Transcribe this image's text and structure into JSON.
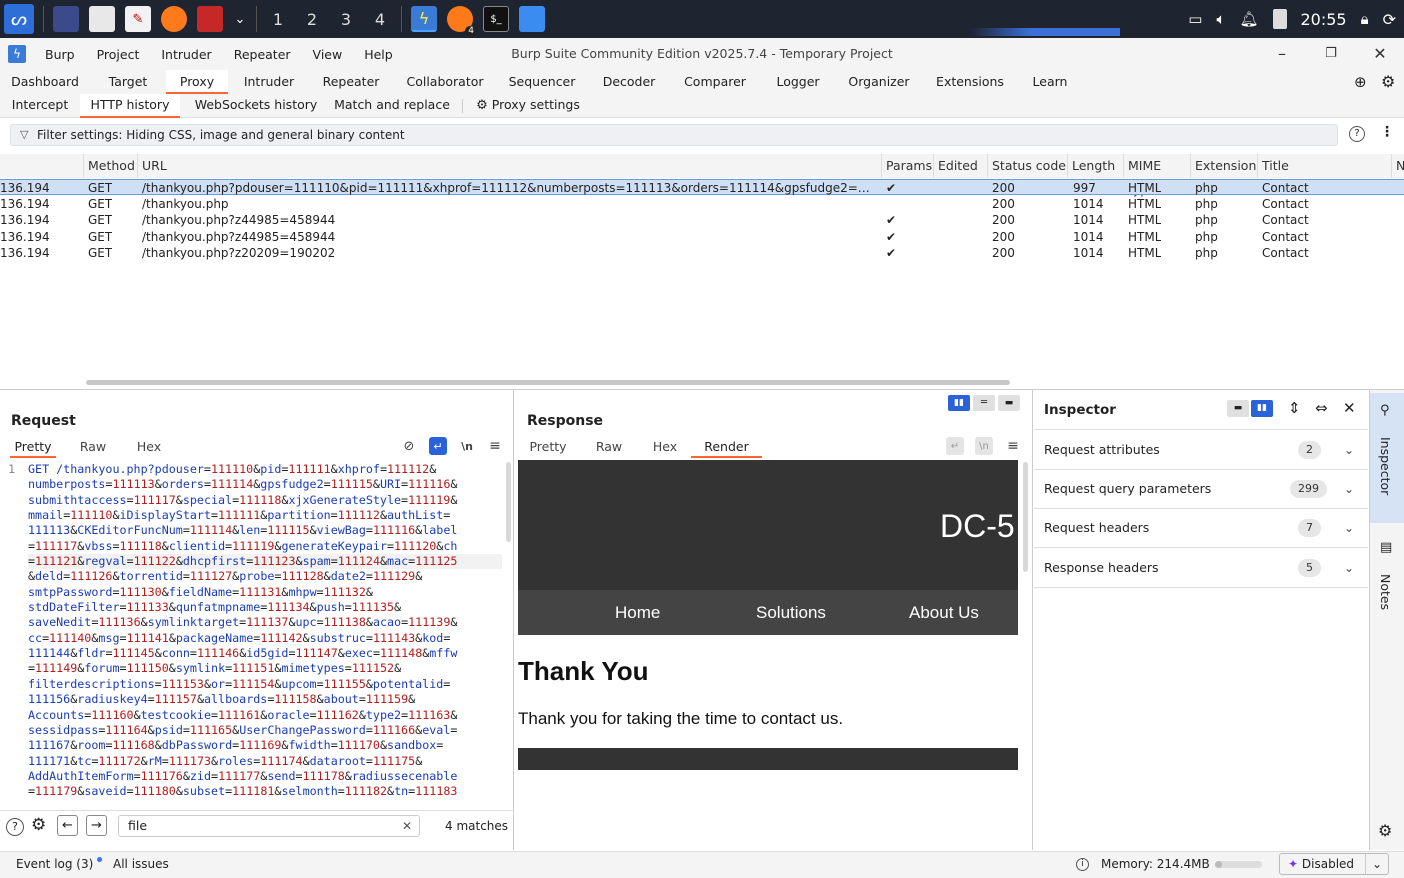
{
  "taskbar": {
    "workspaces": [
      "1",
      "2",
      "3",
      "4"
    ],
    "notification_count": "4",
    "clock": "20:55"
  },
  "window": {
    "menu": [
      "Burp",
      "Project",
      "Intruder",
      "Repeater",
      "View",
      "Help"
    ],
    "title": "Burp Suite Community Edition v2025.7.4 - Temporary Project"
  },
  "main_tabs": [
    "Dashboard",
    "Target",
    "Proxy",
    "Intruder",
    "Repeater",
    "Collaborator",
    "Sequencer",
    "Decoder",
    "Comparer",
    "Logger",
    "Organizer",
    "Extensions",
    "Learn"
  ],
  "sub_tabs": [
    "Intercept",
    "HTTP history",
    "WebSockets history",
    "Match and replace"
  ],
  "proxy_settings_label": "Proxy settings",
  "filter_label": "Filter settings: Hiding CSS, image and general binary content",
  "table": {
    "columns": [
      "Method",
      "URL",
      "Params",
      "Edited",
      "Status code",
      "Length",
      "MIME type",
      "Extension",
      "Title",
      "N"
    ],
    "rows": [
      {
        "host": "136.194",
        "method": "GET",
        "url": "/thankyou.php?pdouser=111110&pid=111111&xhprof=111112&numberposts=111113&orders=111114&gpsfudge2=111115&URI=111116&sub...",
        "params": "✔",
        "edited": "",
        "status": "200",
        "length": "997",
        "mime": "HTML",
        "ext": "php",
        "title": "Contact"
      },
      {
        "host": "136.194",
        "method": "GET",
        "url": "/thankyou.php",
        "params": "",
        "edited": "",
        "status": "200",
        "length": "1014",
        "mime": "HTML",
        "ext": "php",
        "title": "Contact"
      },
      {
        "host": "136.194",
        "method": "GET",
        "url": "/thankyou.php?z44985=458944",
        "params": "✔",
        "edited": "",
        "status": "200",
        "length": "1014",
        "mime": "HTML",
        "ext": "php",
        "title": "Contact"
      },
      {
        "host": "136.194",
        "method": "GET",
        "url": "/thankyou.php?z44985=458944",
        "params": "✔",
        "edited": "",
        "status": "200",
        "length": "1014",
        "mime": "HTML",
        "ext": "php",
        "title": "Contact"
      },
      {
        "host": "136.194",
        "method": "GET",
        "url": "/thankyou.php?z20209=190202",
        "params": "✔",
        "edited": "",
        "status": "200",
        "length": "1014",
        "mime": "HTML",
        "ext": "php",
        "title": "Contact"
      }
    ]
  },
  "request": {
    "title": "Request",
    "tabs": [
      "Pretty",
      "Raw",
      "Hex"
    ],
    "newline_label": "\\n",
    "line_number": "1",
    "lines": [
      "GET /thankyou.php?pdouser=111110&pid=111111&xhprof=111112&",
      "numberposts=111113&orders=111114&gpsfudge2=111115&URI=111116&",
      "submithtaccess=111117&special=111118&xjxGenerateStyle=111119&",
      "mmail=111110&iDisplayStart=111111&partition=111112&authList=",
      "111113&CKEditorFuncNum=111114&len=111115&viewBag=111116&label",
      "=111117&vbss=111118&clientid=111119&generateKeypair=111120&ch",
      "=111121&regval=111122&dhcpfirst=111123&spam=111124&mac=111125",
      "&deld=111126&torrentid=111127&probe=111128&date2=111129&",
      "smtpPassword=111130&fieldName=111131&mhpw=111132&",
      "stdDateFilter=111133&qunfatmpname=111134&push=111135&",
      "saveNedit=111136&symlinktarget=111137&upc=111138&acao=111139&",
      "cc=111140&msg=111141&packageName=111142&substruc=111143&kod=",
      "111144&fldr=111145&conn=111146&id5gid=111147&exec=111148&mffw",
      "=111149&forum=111150&symlink=111151&mimetypes=111152&",
      "filterdescriptions=111153&or=111154&upcom=111155&potentalid=",
      "111156&radiuskey4=111157&allboards=111158&about=111159&",
      "Accounts=111160&testcookie=111161&oracle=111162&type2=111163&",
      "sessidpass=111164&psid=111165&UserChangePassword=111166&eval=",
      "111167&room=111168&dbPassword=111169&fwidth=111170&sandbox=",
      "111171&tc=111172&rM=111173&roles=111174&dataroot=111175&",
      "AddAuthItemForm=111176&zid=111177&send=111178&radiussecenable",
      "=111179&saveid=111180&subset=111181&selmonth=111182&tn=111183"
    ],
    "search_value": "file",
    "matches": "4 matches"
  },
  "response": {
    "title": "Response",
    "tabs": [
      "Pretty",
      "Raw",
      "Hex",
      "Render"
    ],
    "newline_label": "\\n",
    "render": {
      "site_title": "DC-5",
      "nav": [
        "Home",
        "Solutions",
        "About Us"
      ],
      "heading": "Thank You",
      "text": "Thank you for taking the time to contact us."
    }
  },
  "inspector": {
    "title": "Inspector",
    "sections": [
      {
        "label": "Request attributes",
        "count": "2"
      },
      {
        "label": "Request query parameters",
        "count": "299"
      },
      {
        "label": "Request headers",
        "count": "7"
      },
      {
        "label": "Response headers",
        "count": "5"
      }
    ],
    "side_tabs": [
      "Inspector",
      "Notes"
    ]
  },
  "statusbar": {
    "event_log": "Event log (3)",
    "all_issues": "All issues",
    "memory": "Memory: 214.4MB",
    "ai_state": "Disabled"
  },
  "colors": {
    "accent": "#ff6633",
    "selection": "#cfe0f5",
    "render_dark": "#333333",
    "render_nav": "#444444"
  }
}
